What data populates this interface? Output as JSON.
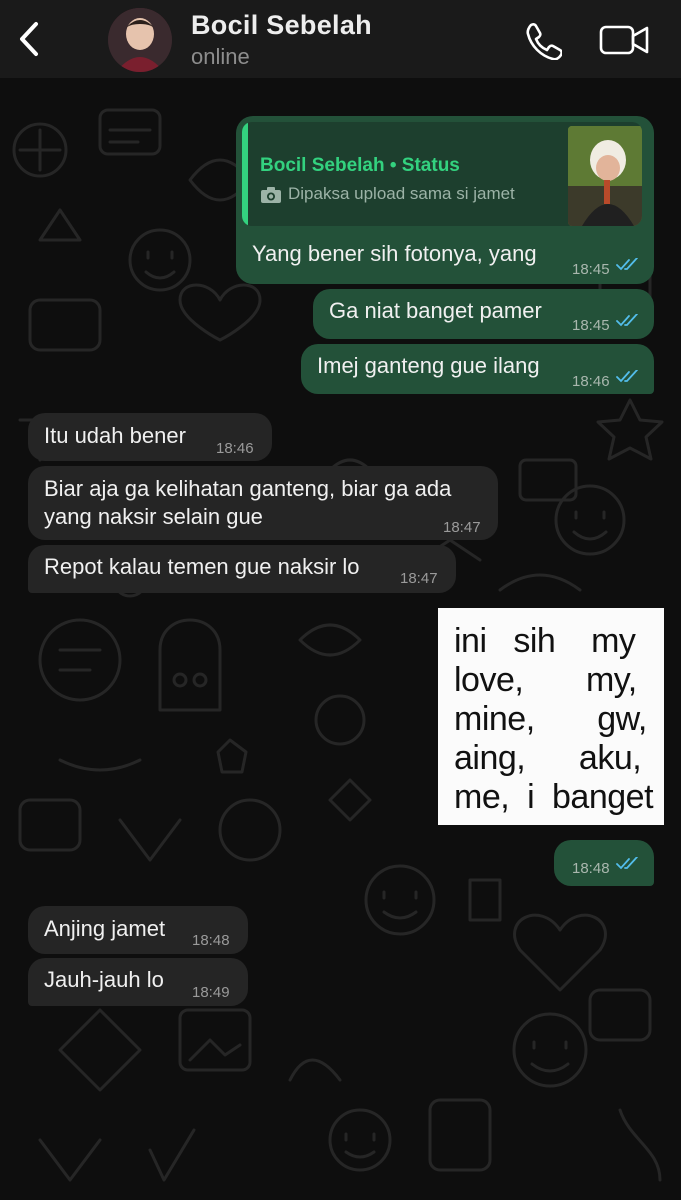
{
  "header": {
    "contact_name": "Bocil Sebelah",
    "status": "online"
  },
  "colors": {
    "header_bg": "#1a1a1a",
    "outgoing_bubble": "#235139",
    "incoming_bubble": "#252525",
    "accent_green": "#33d27f",
    "read_ticks": "#53bdeb"
  },
  "reply_preview": {
    "title": "Bocil Sebelah • Status",
    "snippet": "Dipaksa upload sama si jamet"
  },
  "messages": [
    {
      "dir": "out",
      "text": "Yang bener sih fotonya, yang",
      "time": "18:45"
    },
    {
      "dir": "out",
      "text": "Ga niat banget pamer",
      "time": "18:45"
    },
    {
      "dir": "out",
      "text": "Imej ganteng gue ilang",
      "time": "18:46"
    },
    {
      "dir": "in",
      "text": "Itu udah bener",
      "time": "18:46"
    },
    {
      "dir": "in",
      "text_line1": "Biar aja ga kelihatan ganteng, biar ga ada",
      "text_line2": "yang naksir selain gue",
      "time": "18:47"
    },
    {
      "dir": "in",
      "text": "Repot kalau temen gue naksir lo",
      "time": "18:47"
    },
    {
      "dir": "out",
      "text": "",
      "time": "18:48"
    },
    {
      "dir": "in",
      "text": "Anjing jamet",
      "time": "18:48"
    },
    {
      "dir": "in",
      "text": "Jauh-jauh lo",
      "time": "18:49"
    }
  ],
  "sticker": {
    "lines": [
      "ini   sih    my",
      "love,       my,",
      "mine,       gw,",
      "aing,      aku,",
      "me,  i  banget"
    ]
  }
}
